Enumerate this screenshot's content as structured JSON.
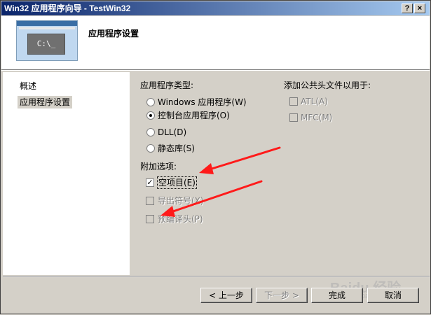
{
  "window": {
    "title": "Win32 应用程序向导 - TestWin32",
    "help_glyph": "?",
    "close_glyph": "×"
  },
  "header": {
    "title": "应用程序设置",
    "thumbnail_text": "C:\\_"
  },
  "nav": {
    "items": [
      {
        "label": "概述"
      },
      {
        "label": "应用程序设置",
        "selected": true
      }
    ]
  },
  "app_type": {
    "label": "应用程序类型:",
    "options": [
      {
        "label": "Windows 应用程序(W)",
        "selected": false
      },
      {
        "label": "控制台应用程序(O)",
        "selected": true
      },
      {
        "label": "DLL(D)",
        "selected": false
      },
      {
        "label": "静态库(S)",
        "selected": false
      }
    ]
  },
  "extra": {
    "label": "附加选项:",
    "options": [
      {
        "label": "空项目(E)",
        "checked": true,
        "enabled": true
      },
      {
        "label": "导出符号(X)",
        "checked": false,
        "enabled": false
      },
      {
        "label": "预编译头(P)",
        "checked": false,
        "enabled": false
      }
    ]
  },
  "headers": {
    "label": "添加公共头文件以用于:",
    "options": [
      {
        "label": "ATL(A)",
        "checked": false,
        "enabled": false
      },
      {
        "label": "MFC(M)",
        "checked": false,
        "enabled": false
      }
    ]
  },
  "buttons": {
    "prev": "< 上一步",
    "next": "下一步 >",
    "finish": "完成",
    "cancel": "取消"
  },
  "watermark": {
    "brand": "Baidu 经验",
    "url": "jingyan.baidu.com"
  },
  "colors": {
    "annotation_arrow": "#ff1a1a",
    "title_bar": "#0a246a"
  }
}
